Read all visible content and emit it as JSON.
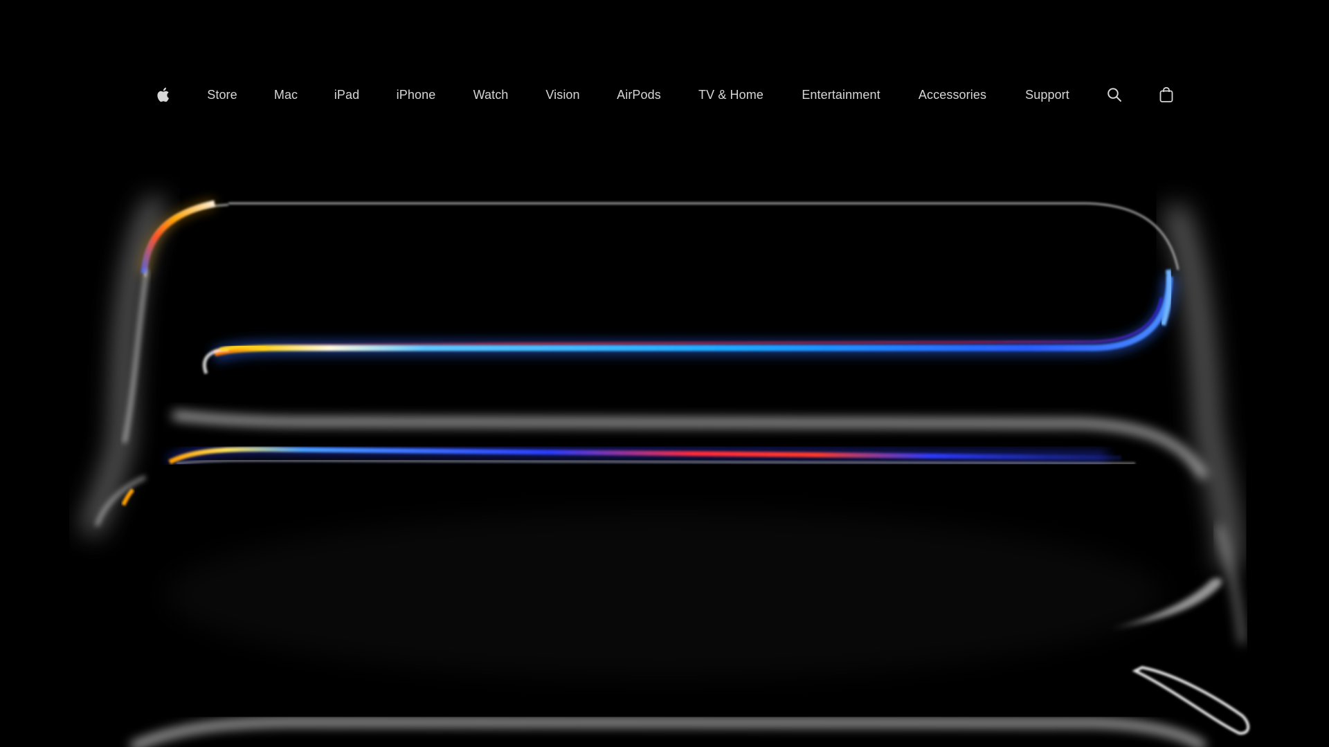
{
  "page": {
    "theme": "dark",
    "background_color": "#000000"
  },
  "globalnav": {
    "logo": {
      "icon": "apple-logo-icon",
      "color": "#d6d6d6"
    },
    "items": [
      {
        "label": "Store"
      },
      {
        "label": "Mac"
      },
      {
        "label": "iPad"
      },
      {
        "label": "iPhone"
      },
      {
        "label": "Watch"
      },
      {
        "label": "Vision"
      },
      {
        "label": "AirPods"
      },
      {
        "label": "TV & Home"
      },
      {
        "label": "Entertainment"
      },
      {
        "label": "Accessories"
      },
      {
        "label": "Support"
      }
    ],
    "search": {
      "icon": "search-icon"
    },
    "bag": {
      "icon": "shopping-bag-icon"
    },
    "text_color": "#d6d6d6"
  },
  "hero": {
    "artwork": "glowing-watch-outline-graphic",
    "accent_colors": [
      "#ff7a00",
      "#ffd21a",
      "#2d6bff",
      "#00b4ff",
      "#ff2a3a",
      "#ffffff"
    ]
  }
}
